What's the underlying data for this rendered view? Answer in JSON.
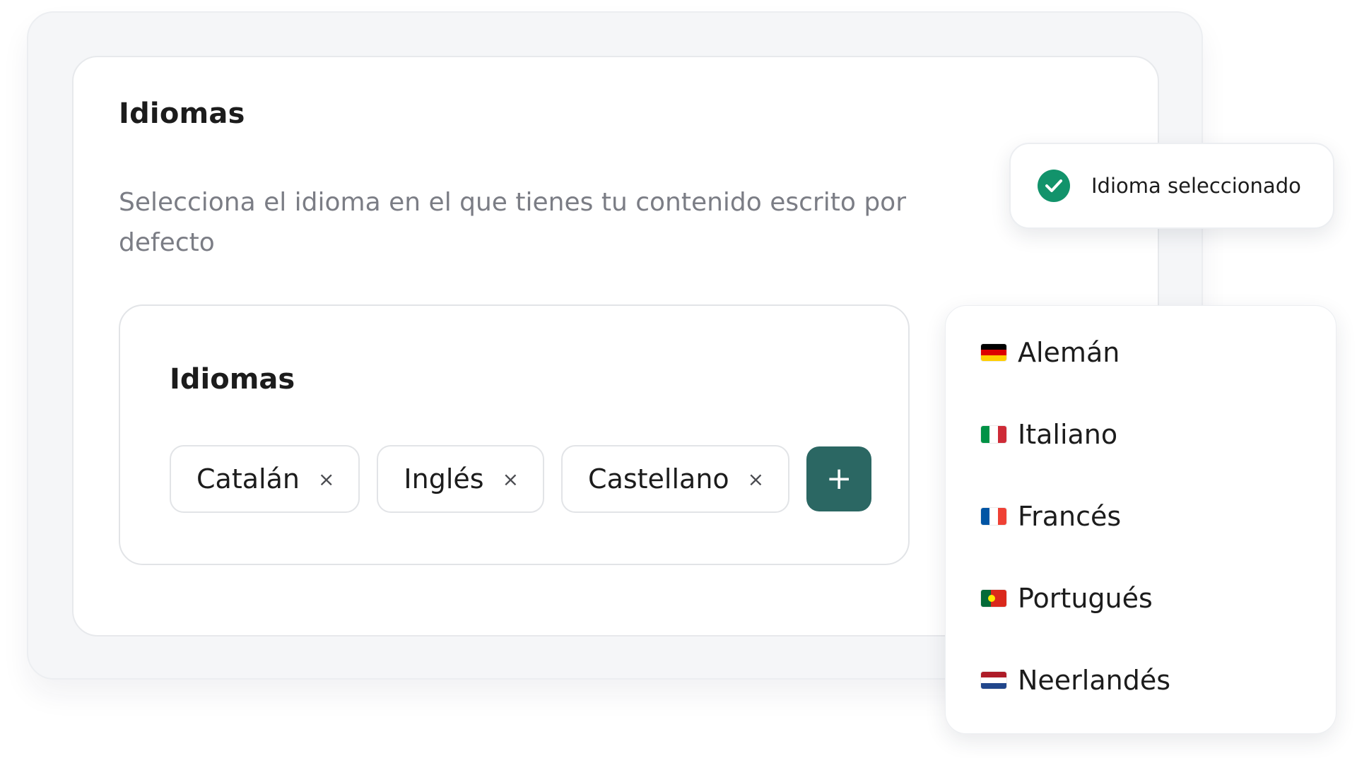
{
  "card": {
    "title": "Idiomas",
    "description": "Selecciona el idioma en el que tienes tu contenido escrito por defecto"
  },
  "field": {
    "label": "Idiomas",
    "chips": [
      {
        "label": "Catalán",
        "remove": "×"
      },
      {
        "label": "Inglés",
        "remove": "×"
      },
      {
        "label": "Castellano",
        "remove": "×"
      }
    ],
    "add_label": "+"
  },
  "toast": {
    "message": "Idioma seleccionado",
    "icon": "check-circle-icon",
    "color": "#12936b"
  },
  "dropdown": {
    "options": [
      {
        "label": "Alemán",
        "flag": "flag-de-icon"
      },
      {
        "label": "Italiano",
        "flag": "flag-it-icon"
      },
      {
        "label": "Francés",
        "flag": "flag-fr-icon"
      },
      {
        "label": "Portugués",
        "flag": "flag-pt-icon"
      },
      {
        "label": "Neerlandés",
        "flag": "flag-nl-icon"
      }
    ]
  },
  "colors": {
    "accent": "#2b6763",
    "success": "#12936b"
  }
}
